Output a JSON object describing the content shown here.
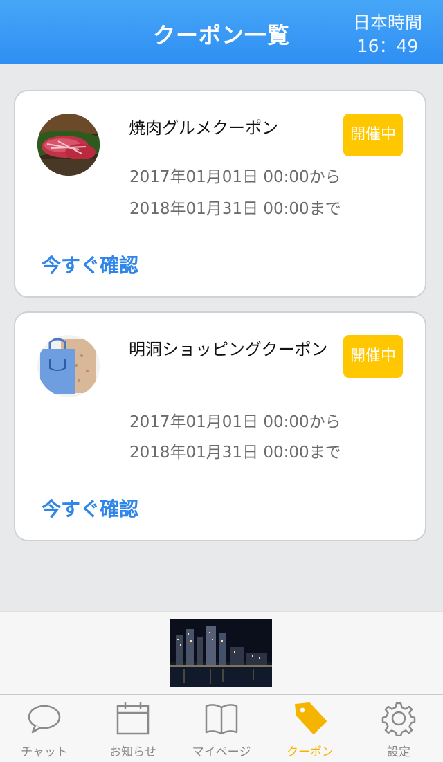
{
  "header": {
    "title": "クーポン一覧",
    "clock_label": "日本時間",
    "clock_time": "16：49"
  },
  "coupons": [
    {
      "title": "焼肉グルメクーポン",
      "status": "開催中",
      "start": "2017年01月01日 00:00から",
      "end": "2018年01月31日 00:00まで",
      "cta": "今すぐ確認",
      "image": "grilled-meat-photo"
    },
    {
      "title": "明洞ショッピングクーポン",
      "status": "開催中",
      "start": "2017年01月01日 00:00から",
      "end": "2018年01月31日 00:00まで",
      "cta": "今すぐ確認",
      "image": "shopping-bags-photo"
    }
  ],
  "ad": {
    "image": "night-city-skyline-photo"
  },
  "tabbar": {
    "items": [
      {
        "label": "チャット",
        "icon": "chat-bubble-icon"
      },
      {
        "label": "お知らせ",
        "icon": "calendar-icon"
      },
      {
        "label": "マイページ",
        "icon": "book-icon"
      },
      {
        "label": "クーポン",
        "icon": "tag-icon"
      },
      {
        "label": "設定",
        "icon": "gear-icon"
      }
    ],
    "active_index": 3
  },
  "colors": {
    "header_blue": "#3a9af5",
    "badge_yellow": "#ffc700",
    "link_blue": "#2f86e8",
    "active_tab": "#f5b400"
  }
}
